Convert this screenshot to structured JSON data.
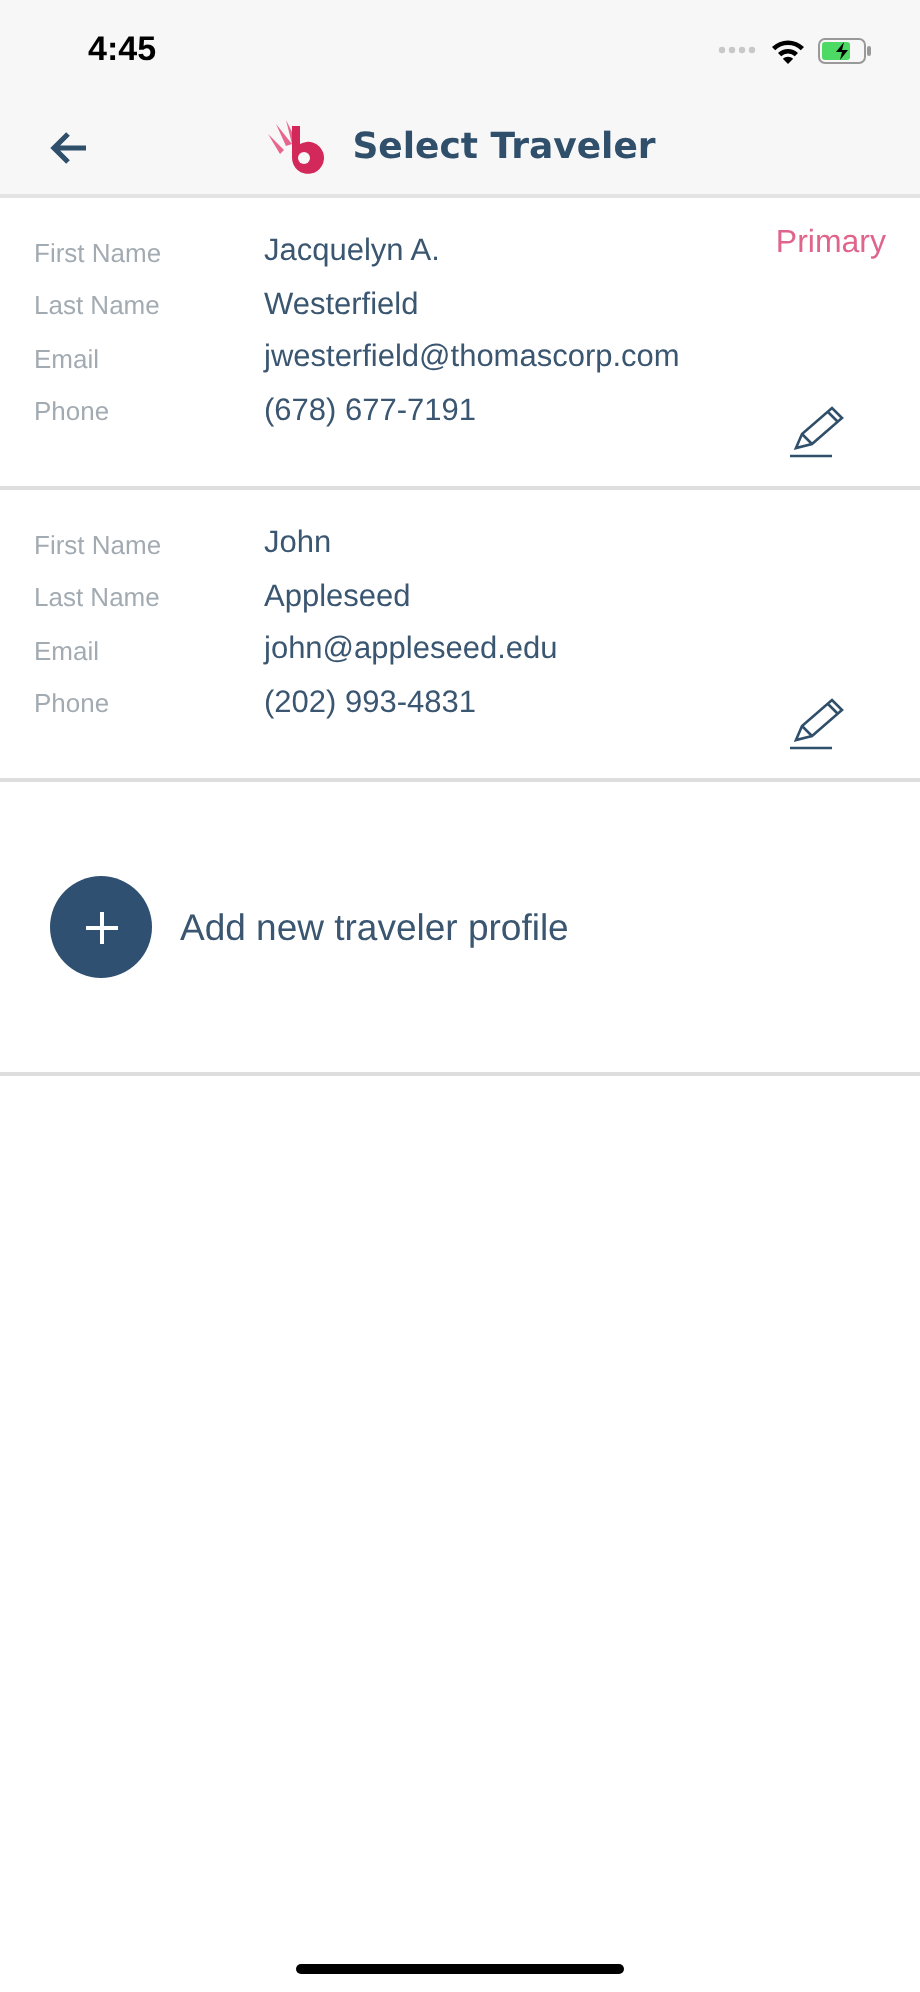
{
  "status_bar": {
    "time": "4:45"
  },
  "nav": {
    "title": "Select Traveler"
  },
  "travelers": [
    {
      "tag": "Primary",
      "fields": [
        {
          "label": "First Name",
          "value": "Jacquelyn A."
        },
        {
          "label": "Last Name",
          "value": "Westerfield"
        },
        {
          "label": "Email",
          "value": "jwesterfield@thomascorp.com"
        },
        {
          "label": "Phone",
          "value": "(678) 677-7191"
        }
      ]
    },
    {
      "fields": [
        {
          "label": "First Name",
          "value": "John"
        },
        {
          "label": "Last Name",
          "value": "Appleseed"
        },
        {
          "label": "Email",
          "value": "john@appleseed.edu"
        },
        {
          "label": "Phone",
          "value": "(202) 993-4831"
        }
      ]
    }
  ],
  "add_button": {
    "label": "Add new traveler profile"
  }
}
